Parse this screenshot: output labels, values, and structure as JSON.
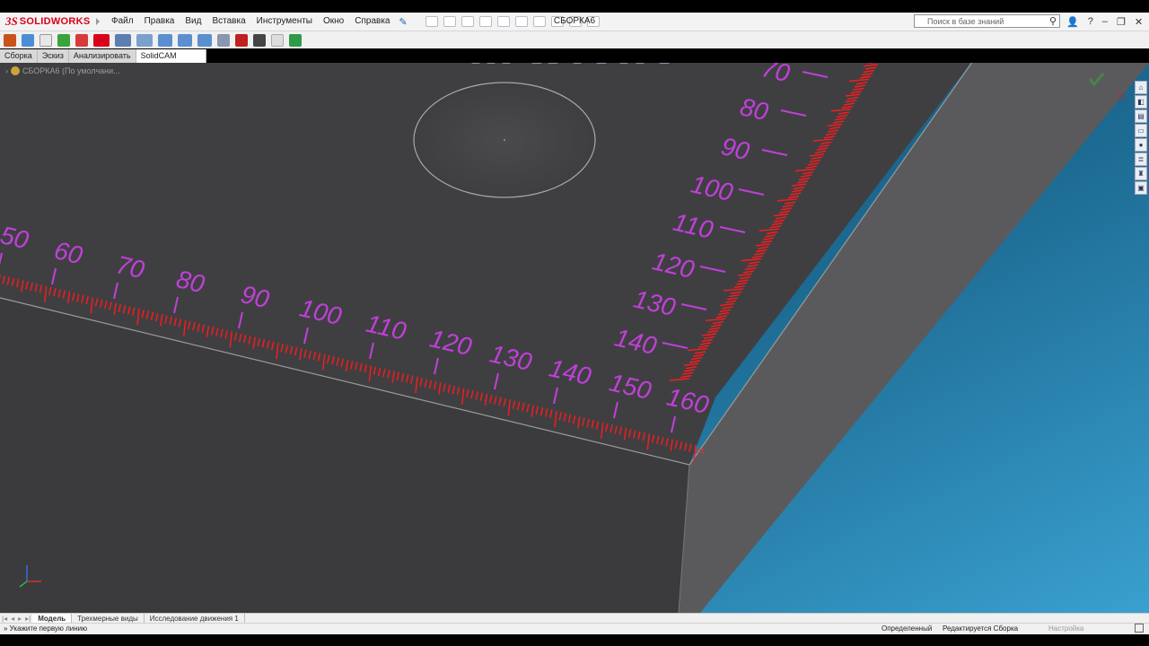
{
  "app": {
    "logo_ds": "3S",
    "logo_name": "SOLIDWORKS",
    "document_title": "СБОРКА6"
  },
  "menu": [
    "Файл",
    "Правка",
    "Вид",
    "Вставка",
    "Инструменты",
    "Окно",
    "Справка"
  ],
  "search": {
    "placeholder": "Поиск в базе знаний"
  },
  "window_controls": {
    "help": "?",
    "minimize": "–",
    "maximize": "❐",
    "close": "✕"
  },
  "tabs": [
    {
      "label": "Сборка",
      "active": false
    },
    {
      "label": "Эскиз",
      "active": false
    },
    {
      "label": "Анализировать",
      "active": false
    },
    {
      "label": "SolidCAM Переходы",
      "active": true
    }
  ],
  "tree": {
    "root_label": "СБОРКА6 (По умолчани..."
  },
  "ruler": {
    "color": "#ff1a1a",
    "label_color": "#c040d8",
    "horizontal_labels": [
      "50",
      "60",
      "70",
      "80",
      "90",
      "100",
      "110",
      "120",
      "130",
      "140",
      "150",
      "160"
    ],
    "vertical_labels": [
      "70",
      "80",
      "90",
      "100",
      "110",
      "120",
      "130",
      "140"
    ],
    "end_mark": "01"
  },
  "bottom_tabs": [
    {
      "label": "Модель",
      "active": true
    },
    {
      "label": "Трехмерные виды",
      "active": false
    },
    {
      "label": "Исследование движения 1",
      "active": false
    }
  ],
  "status": {
    "message": "Укажите первую линию",
    "state": "Определенный",
    "mode": "Редактируется Сборка",
    "settings": "Настройка"
  },
  "colors": {
    "accent": "#d9001b",
    "viewport_bg": "#1b5a80",
    "part_top": "#3f3f42",
    "part_side": "#5a5a5d"
  }
}
